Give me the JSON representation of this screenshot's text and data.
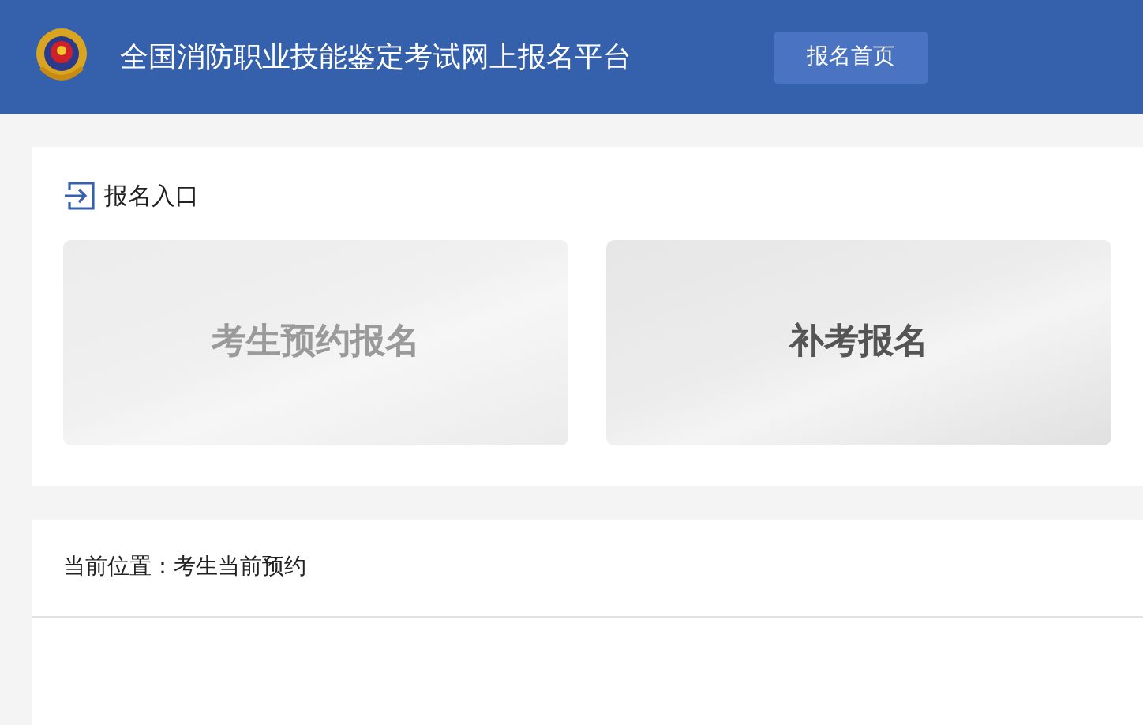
{
  "header": {
    "title": "全国消防职业技能鉴定考试网上报名平台",
    "home_button": "报名首页"
  },
  "entry_section": {
    "title": "报名入口",
    "cards": [
      {
        "label": "考生预约报名",
        "disabled": true
      },
      {
        "label": "补考报名",
        "disabled": false
      }
    ]
  },
  "breadcrumb": {
    "label": "当前位置：",
    "current": "考生当前预约"
  }
}
